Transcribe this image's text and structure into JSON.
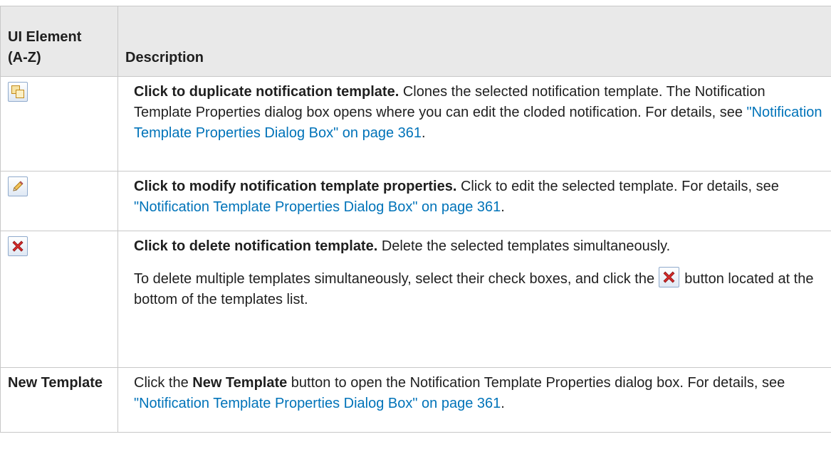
{
  "header": {
    "col1_line1": "UI Element",
    "col1_line2": "(A-Z)",
    "col2": "Description"
  },
  "rows": [
    {
      "element_icon": "duplicate-icon",
      "lead": "Click to duplicate notification template.",
      "text_before_link": " Clones the selected notification template. The Notification Template Properties dialog box opens where you can edit the cloded notification. For details, see ",
      "link": "\"Notification Template Properties Dialog Box\" on page 361",
      "text_after_link": "."
    },
    {
      "element_icon": "edit-pencil-icon",
      "lead": "Click to modify notification template properties.",
      "text_before_link": " Click to edit the selected template. For details, see ",
      "link": "\"Notification Template Properties Dialog Box\" on page 361",
      "text_after_link": "."
    },
    {
      "element_icon": "delete-x-icon",
      "lead": "Click to delete notification template.",
      "text": " Delete the selected templates simultaneously.",
      "para2_before_icon": "To delete multiple templates simultaneously, select their check boxes, and click the ",
      "para2_after_icon": " button located at the bottom of the templates list."
    },
    {
      "element_text": "New Template",
      "text_before_bold": "Click the ",
      "bold": "New Template",
      "text_before_link": " button to open the Notification Template Properties dialog box. For details, see ",
      "link": "\"Notification Template Properties Dialog Box\" on page 361",
      "text_after_link": "."
    }
  ],
  "colors": {
    "link": "#0073b9",
    "header_bg": "#e9e9e9",
    "border": "#c8c8c8",
    "delete_red": "#d62a2a"
  }
}
